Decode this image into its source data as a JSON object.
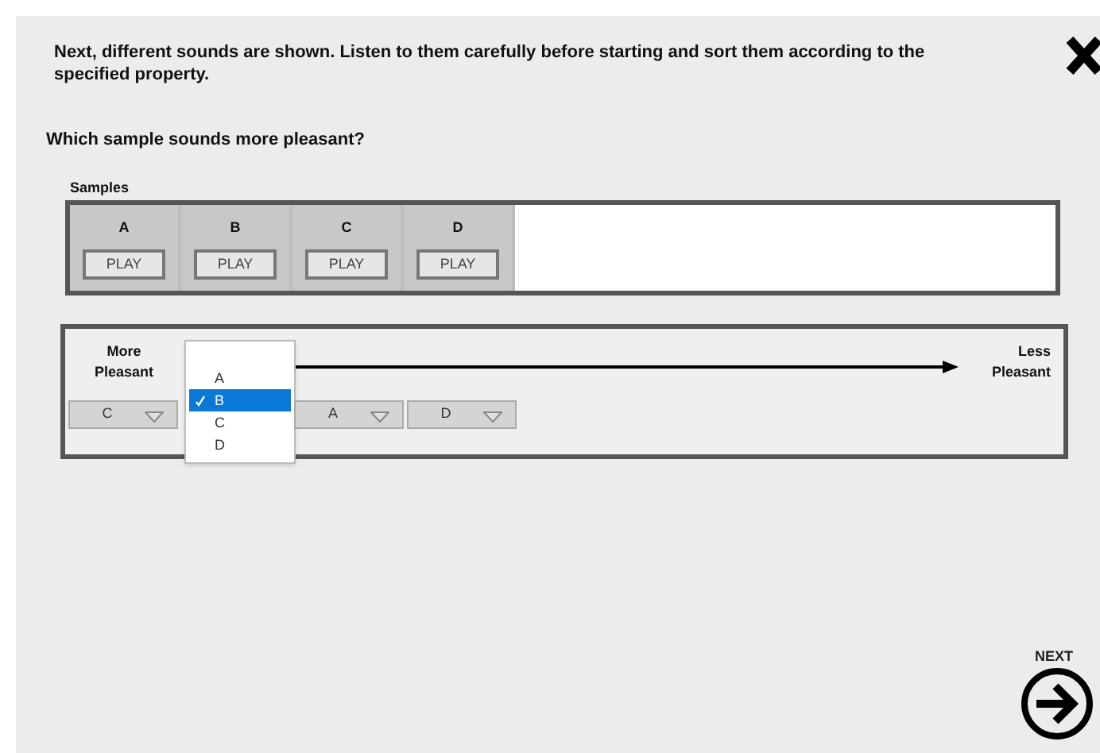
{
  "instructions": "Next, different sounds are shown. Listen to them carefully before starting and sort them according to the specified property.",
  "question": "Which sample sounds more pleasant?",
  "samples": {
    "label": "Samples",
    "items": [
      {
        "name": "A",
        "button": "PLAY"
      },
      {
        "name": "B",
        "button": "PLAY"
      },
      {
        "name": "C",
        "button": "PLAY"
      },
      {
        "name": "D",
        "button": "PLAY"
      }
    ]
  },
  "ranking": {
    "start_label": "More Pleasant",
    "end_label": "Less Pleasant",
    "slots": [
      {
        "kind": "select",
        "value": "C"
      },
      {
        "kind": "menu",
        "options": [
          {
            "label": "A",
            "selected": false
          },
          {
            "label": "B",
            "selected": true
          },
          {
            "label": "C",
            "selected": false
          },
          {
            "label": "D",
            "selected": false
          }
        ]
      },
      {
        "kind": "select",
        "value": "A"
      },
      {
        "kind": "select",
        "value": "D"
      }
    ]
  },
  "next": {
    "label": "NEXT"
  }
}
